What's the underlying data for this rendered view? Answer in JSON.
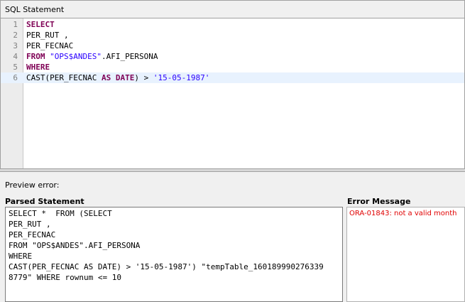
{
  "panel": {
    "title": "SQL Statement"
  },
  "editor": {
    "line_numbers": [
      "1",
      "2",
      "3",
      "4",
      "5",
      "6"
    ],
    "lines": [
      [
        {
          "t": "SELECT",
          "c": "kw"
        }
      ],
      [
        {
          "t": "PER_RUT ,",
          "c": ""
        }
      ],
      [
        {
          "t": "PER_FECNAC",
          "c": ""
        }
      ],
      [
        {
          "t": "FROM",
          "c": "kw"
        },
        {
          "t": " ",
          "c": ""
        },
        {
          "t": "\"OPS$ANDES\"",
          "c": "str"
        },
        {
          "t": ".AFI_PERSONA",
          "c": ""
        }
      ],
      [
        {
          "t": "WHERE",
          "c": "kw"
        }
      ],
      [
        {
          "t": "CAST(PER_FECNAC ",
          "c": ""
        },
        {
          "t": "AS",
          "c": "kw"
        },
        {
          "t": " ",
          "c": ""
        },
        {
          "t": "DATE",
          "c": "kw"
        },
        {
          "t": ") > ",
          "c": ""
        },
        {
          "t": "'15-05-1987'",
          "c": "str"
        }
      ]
    ],
    "current_line": 6
  },
  "preview": {
    "label": "Preview error:",
    "parsed_label": "Parsed Statement",
    "parsed_lines": [
      "SELECT *  FROM (SELECT",
      "PER_RUT ,",
      "PER_FECNAC",
      "FROM \"OPS$ANDES\".AFI_PERSONA",
      "WHERE",
      "CAST(PER_FECNAC AS DATE) > '15-05-1987') \"tempTable_160189990276339",
      "8779\" WHERE rownum <= 10"
    ],
    "error_label": "Error Message",
    "error_text": "ORA-01843: not a valid month"
  }
}
